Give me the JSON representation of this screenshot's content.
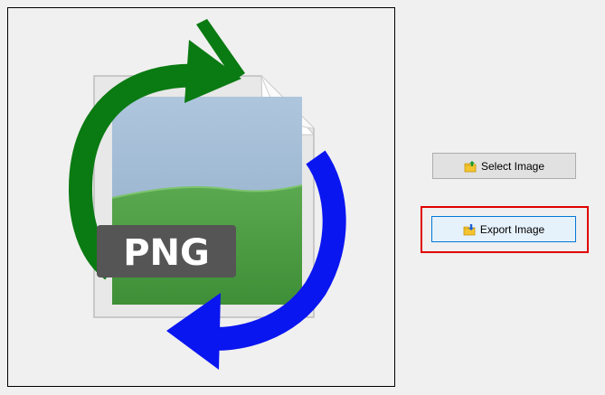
{
  "preview": {
    "badge_text": "PNG",
    "image_description_icon": "png-convert-icon"
  },
  "buttons": {
    "select_label": "Select Image",
    "export_label": "Export Image"
  },
  "icons": {
    "select": "folder-upload-icon",
    "export": "folder-download-icon"
  },
  "colors": {
    "highlight": "#e00000",
    "arrow_green": "#0a7a12",
    "arrow_blue": "#0a16f0",
    "focus_border": "#0078d7"
  }
}
